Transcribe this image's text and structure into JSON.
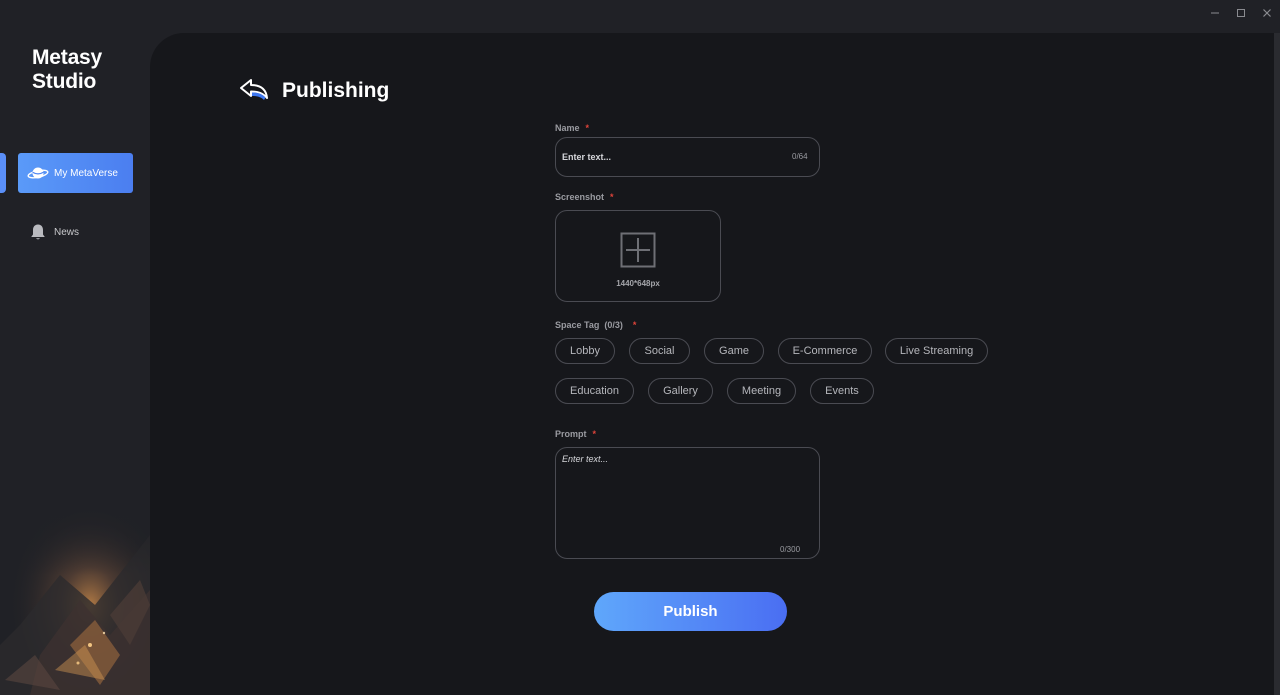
{
  "window": {
    "minimize_icon": "minimize-icon",
    "maximize_icon": "maximize-icon",
    "close_icon": "close-icon"
  },
  "sidebar": {
    "app_title": "Metasy Studio",
    "items": [
      {
        "label": "My MetaVerse",
        "icon": "planet-icon",
        "active": true
      },
      {
        "label": "News",
        "icon": "bell-icon",
        "active": false
      }
    ],
    "accent_color": "#5a8ff8"
  },
  "header": {
    "title": "Publishing",
    "back_icon": "back-arrow-icon"
  },
  "form": {
    "name": {
      "label": "Name",
      "required_mark": "*",
      "placeholder": "Enter text...",
      "counter": "0/64"
    },
    "screenshot": {
      "label": "Screenshot",
      "required_mark": "*",
      "hint": "1440*648px",
      "icon": "add-image-icon"
    },
    "space_tag": {
      "label": "Space Tag  (0/3)",
      "required_mark": "*",
      "tags": [
        "Lobby",
        "Social",
        "Game",
        "E-Commerce",
        "Live Streaming",
        "Education",
        "Gallery",
        "Meeting",
        "Events"
      ]
    },
    "prompt": {
      "label": "Prompt",
      "required_mark": "*",
      "placeholder": "Enter text...",
      "counter": "0/300"
    },
    "publish_label": "Publish"
  },
  "colors": {
    "required": "#e0443a",
    "publish_gradient_start": "#5fa7fb",
    "publish_gradient_end": "#4a6ef2"
  }
}
